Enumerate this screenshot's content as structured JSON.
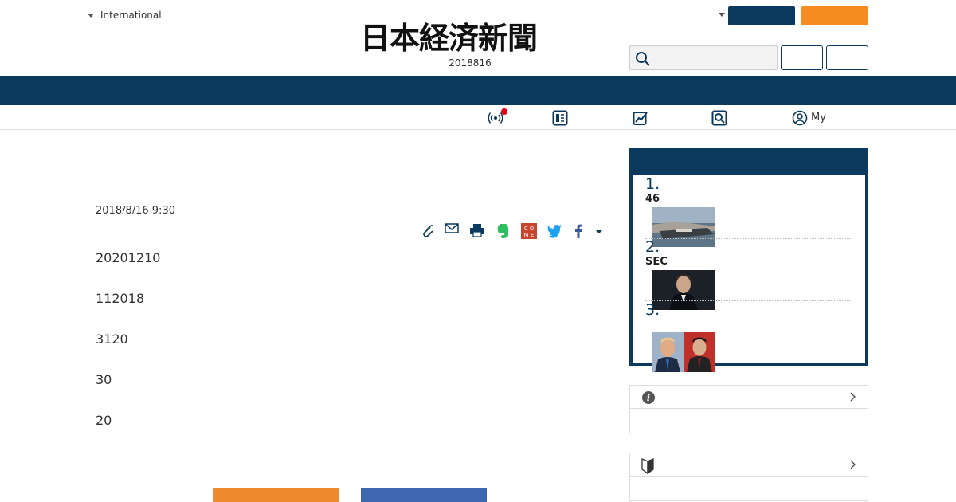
{
  "header": {
    "edition_label": "International",
    "logo_text": "日本経済新聞",
    "date": "2018816"
  },
  "search": {
    "placeholder": ""
  },
  "subnav": {
    "my_label": "My"
  },
  "article": {
    "date": "2018/8/16 9:30",
    "paragraphs": [
      "20201210",
      "112018",
      "3120",
      "30",
      "20"
    ]
  },
  "ranking": {
    "items": [
      {
        "num": "1.",
        "title": "46"
      },
      {
        "num": "2.",
        "title": "SEC"
      },
      {
        "num": "3.",
        "title": ""
      }
    ]
  },
  "colors": {
    "navy": "#0b3a5e",
    "orange": "#f68b1f",
    "notification": "#e60012"
  },
  "icons": {
    "subnav": [
      "broadcast-icon",
      "paper-icon",
      "chart-icon",
      "search-icon",
      "user-icon"
    ],
    "share": [
      "clip-icon",
      "mail-icon",
      "print-icon",
      "evernote-icon",
      "comment-icon",
      "twitter-icon",
      "facebook-icon",
      "caret-down-icon"
    ],
    "panels": [
      "info-icon",
      "beginner-mark-icon"
    ]
  }
}
